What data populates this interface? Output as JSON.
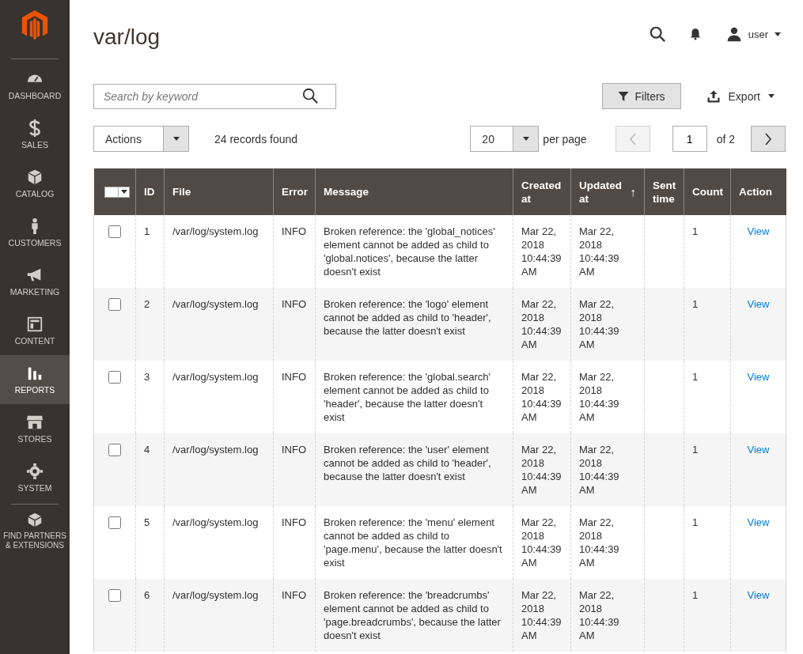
{
  "sidebar": {
    "items": [
      {
        "label": "DASHBOARD",
        "selected": false
      },
      {
        "label": "SALES",
        "selected": false
      },
      {
        "label": "CATALOG",
        "selected": false
      },
      {
        "label": "CUSTOMERS",
        "selected": false
      },
      {
        "label": "MARKETING",
        "selected": false
      },
      {
        "label": "CONTENT",
        "selected": false
      },
      {
        "label": "REPORTS",
        "selected": true
      },
      {
        "label": "STORES",
        "selected": false
      },
      {
        "label": "SYSTEM",
        "selected": false
      },
      {
        "label": "FIND PARTNERS & EXTENSIONS",
        "selected": false
      }
    ]
  },
  "page": {
    "title": "var/log",
    "user": "user"
  },
  "toolbar": {
    "search": {
      "placeholder": "Search by keyword"
    },
    "filters": "Filters",
    "export": "Export",
    "actions": "Actions",
    "records": "24 records found",
    "per_page_value": "20",
    "per_page_label": "per page",
    "page_value": "1",
    "page_total": "of 2"
  },
  "table": {
    "columns": [
      {
        "kind": "select",
        "checked": false
      },
      {
        "label": "ID"
      },
      {
        "label": "File"
      },
      {
        "label": "Error"
      },
      {
        "label": "Message"
      },
      {
        "label": "Created at"
      },
      {
        "label": "Updated at",
        "sort_indicator": "↑"
      },
      {
        "label": "Sent time"
      },
      {
        "label": "Count"
      },
      {
        "label": "Action"
      }
    ],
    "rows": [
      {
        "checked": false,
        "id": "1",
        "file": "/var/log/system.log",
        "error": "INFO",
        "message": "Broken reference: the 'global_notices' element cannot be added as child to 'global.notices', because the latter doesn't exist",
        "created": "Mar 22, 2018 10:44:39 AM",
        "updated": "Mar 22, 2018 10:44:39 AM",
        "count": "1",
        "action": "View"
      },
      {
        "checked": false,
        "id": "2",
        "file": "/var/log/system.log",
        "error": "INFO",
        "message": "Broken reference: the 'logo' element cannot be added as child to 'header', because the latter doesn't exist",
        "created": "Mar 22, 2018 10:44:39 AM",
        "updated": "Mar 22, 2018 10:44:39 AM",
        "count": "1",
        "action": "View"
      },
      {
        "checked": false,
        "id": "3",
        "file": "/var/log/system.log",
        "error": "INFO",
        "message": "Broken reference: the 'global.search' element cannot be added as child to 'header', because the latter doesn't exist",
        "created": "Mar 22, 2018 10:44:39 AM",
        "updated": "Mar 22, 2018 10:44:39 AM",
        "count": "1",
        "action": "View"
      },
      {
        "checked": false,
        "id": "4",
        "file": "/var/log/system.log",
        "error": "INFO",
        "message": "Broken reference: the 'user' element cannot be added as child to 'header', because the latter doesn't exist",
        "created": "Mar 22, 2018 10:44:39 AM",
        "updated": "Mar 22, 2018 10:44:39 AM",
        "count": "1",
        "action": "View"
      },
      {
        "checked": false,
        "id": "5",
        "file": "/var/log/system.log",
        "error": "INFO",
        "message": "Broken reference: the 'menu' element cannot be added as child to 'page.menu', because the latter doesn't exist",
        "created": "Mar 22, 2018 10:44:39 AM",
        "updated": "Mar 22, 2018 10:44:39 AM",
        "count": "1",
        "action": "View"
      },
      {
        "checked": false,
        "id": "6",
        "file": "/var/log/system.log",
        "error": "INFO",
        "message": "Broken reference: the 'breadcrumbs' element cannot be added as child to 'page.breadcrumbs', because the latter doesn't exist",
        "created": "Mar 22, 2018 10:44:39 AM",
        "updated": "Mar 22, 2018 10:44:39 AM",
        "count": "1",
        "action": "View"
      }
    ]
  }
}
